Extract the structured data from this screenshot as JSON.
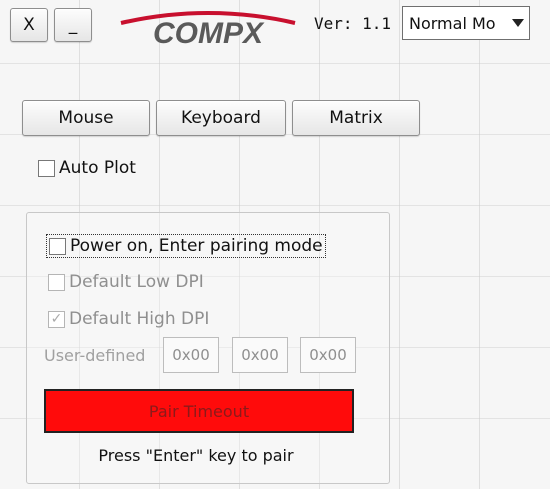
{
  "window": {
    "close_label": "X",
    "minimize_label": "_",
    "logo_text": "COMPX",
    "version_text": "Ver: 1.1",
    "mode_select_value": "Normal Mo"
  },
  "tabs": [
    "Mouse",
    "Keyboard",
    "Matrix"
  ],
  "auto_plot": {
    "label": "Auto Plot",
    "checked": false
  },
  "pairing": {
    "options": [
      {
        "label": "Power on, Enter pairing mode",
        "checked": false,
        "enabled": true
      },
      {
        "label": "Default Low DPI",
        "checked": false,
        "enabled": false
      },
      {
        "label": "Default High DPI",
        "checked": true,
        "enabled": false
      }
    ],
    "user_defined_label": "User-defined",
    "user_defined_values": [
      "0x00",
      "0x00",
      "0x00"
    ],
    "status_text": "Pair Timeout",
    "status_color": "#ff0b0b",
    "hint_text": "Press \"Enter\" key to pair"
  }
}
